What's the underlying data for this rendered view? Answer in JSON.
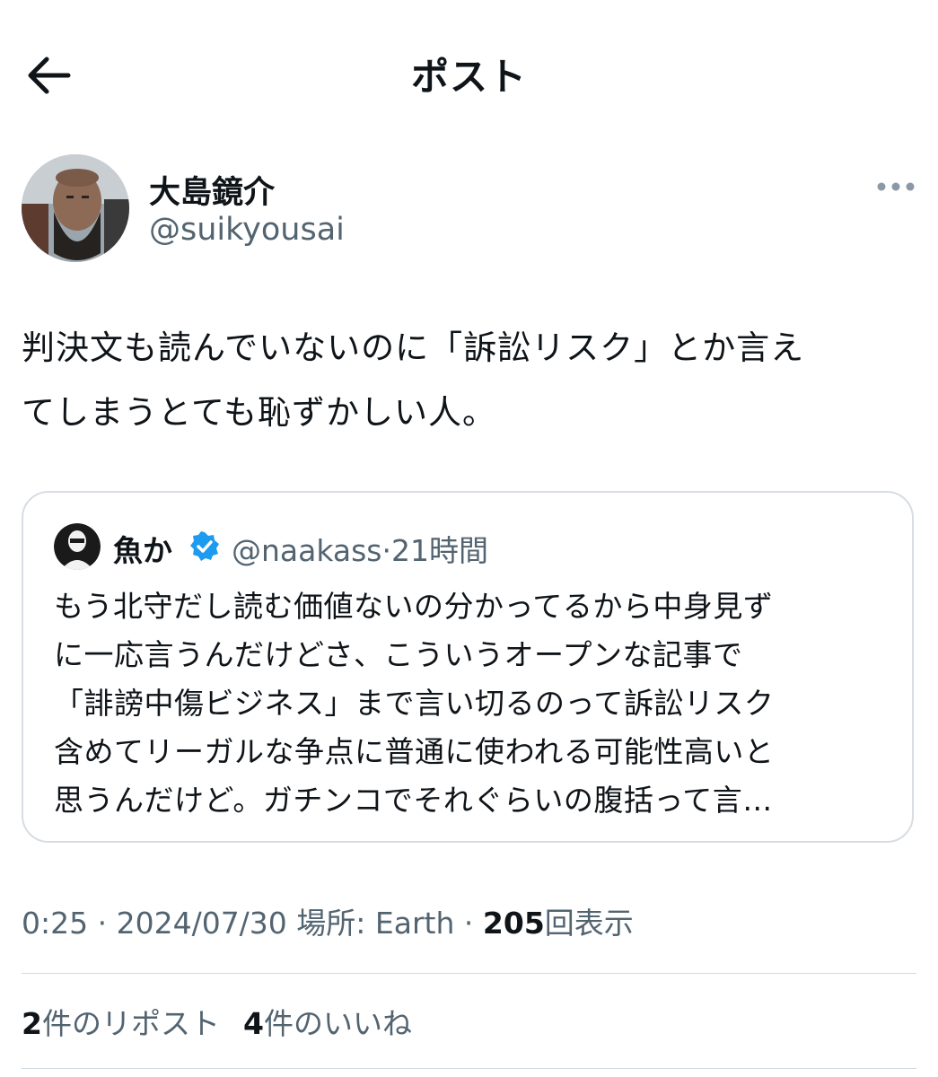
{
  "header": {
    "title": "ポスト",
    "back_icon": "arrow-left-icon"
  },
  "author": {
    "display_name": "大島鏡介",
    "handle": "@suikyousai",
    "more_icon": "more-horizontal-icon"
  },
  "post": {
    "text": "判決文も読んでいないのに「訴訟リスク」とか言え\nてしまうとても恥ずかしい人。"
  },
  "quoted_post": {
    "display_name": "魚か",
    "verified_icon": "verified-badge-icon",
    "handle": "@naakass",
    "separator": "·",
    "time": "21時間",
    "text": "もう北守だし読む価値ないの分かってるから中身見ず\nに一応言うんだけどさ、こういうオープンな記事で\n「誹謗中傷ビジネス」まで言い切るのって訴訟リスク\n含めてリーガルな争点に普通に使われる可能性高いと\n思うんだけど。ガチンコでそれぐらいの腹括って言…"
  },
  "meta": {
    "time": "0:25",
    "sep1": " · ",
    "date": "2024/07/30",
    "location": "場所: Earth",
    "sep2": " · ",
    "views_count": "205",
    "views_label": "回表示"
  },
  "stats": {
    "reposts_count": "2",
    "reposts_label": "件のリポスト",
    "likes_count": "4",
    "likes_label": "件のいいね"
  },
  "colors": {
    "text": "#0f1419",
    "secondary": "#536471",
    "border": "#d7dde2",
    "verified": "#1d9bf0"
  }
}
